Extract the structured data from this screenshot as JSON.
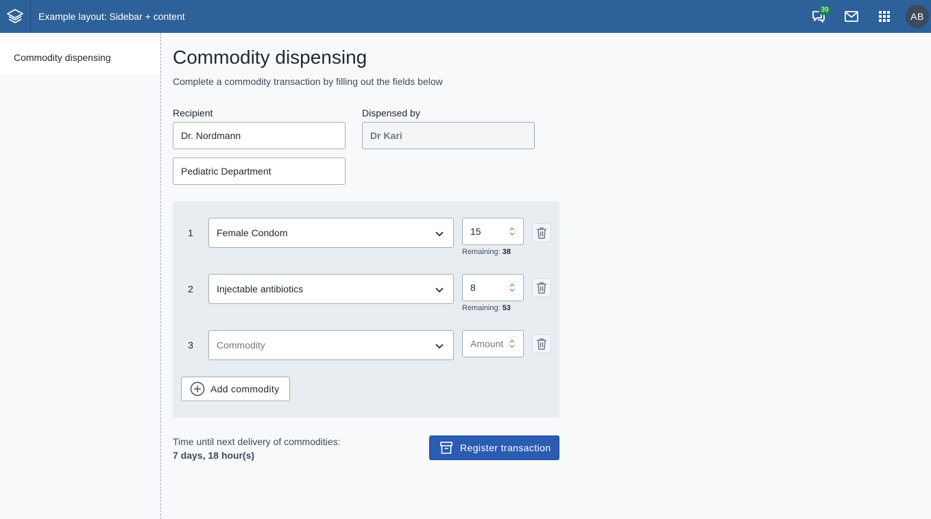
{
  "header": {
    "app_title": "Example layout: Sidebar + content",
    "interpretations_badge": "39",
    "avatar_initials": "AB",
    "icons": [
      "logo-icon",
      "interpretations-icon",
      "messages-icon",
      "apps-icon"
    ],
    "brand_color": "#2d6199"
  },
  "sidebar": {
    "items": [
      {
        "label": "Commodity dispensing",
        "selected": true
      }
    ]
  },
  "main": {
    "title": "Commodity dispensing",
    "subtitle": "Complete a commodity transaction by filling out the fields below",
    "recipient": {
      "label": "Recipient",
      "name_value": "Dr. Nordmann",
      "department_value": "Pediatric Department"
    },
    "dispensed_by": {
      "label": "Dispensed by",
      "value": "Dr Kari"
    },
    "commodities": [
      {
        "number": "1",
        "commodity": "Female Condom",
        "amount": "15",
        "remaining_label": "Remaining:",
        "remaining_value": "38"
      },
      {
        "number": "2",
        "commodity": "Injectable antibiotics",
        "amount": "8",
        "remaining_label": "Remaining:",
        "remaining_value": "53"
      },
      {
        "number": "3",
        "commodity_placeholder": "Commodity",
        "amount_placeholder": "Amount"
      }
    ],
    "add_commodity_label": "Add commodity",
    "delivery": {
      "label": "Time until next delivery of commodities:",
      "value": "7 days, 18 hour(s)"
    },
    "register_button_label": "Register transaction",
    "primary_color": "#2b5cb2"
  }
}
